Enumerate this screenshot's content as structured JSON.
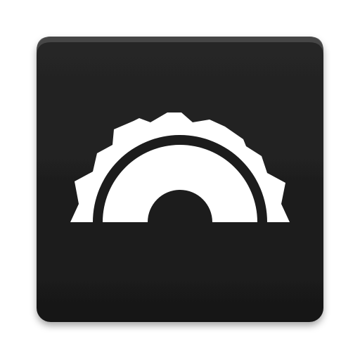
{
  "icon": {
    "name": "half-gear-icon",
    "tile_color": "#1c1c1c",
    "tile_highlight_color": "#4a4a4a",
    "glyph_color": "#ffffff",
    "background_color": "#ffffff"
  }
}
